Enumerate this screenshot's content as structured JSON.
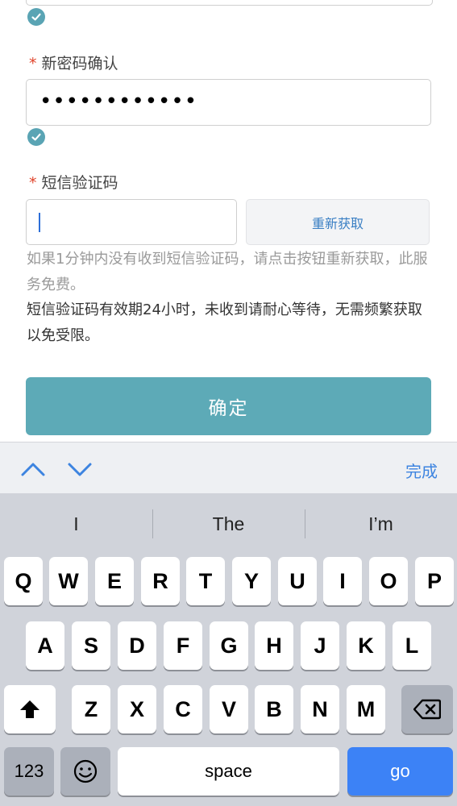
{
  "form": {
    "check_top": "check",
    "new_pwd_confirm_label": "新密码确认",
    "new_pwd_confirm_value": "••••••••••••",
    "sms_label": "短信验证码",
    "sms_input_value": "",
    "resend_label": "重新获取",
    "hint1": "如果1分钟内没有收到短信验证码，请点击按钮重新获取，此服务免费。",
    "hint2": "短信验证码有效期24小时，未收到请耐心等待，无需频繁获取以免受限。",
    "submit_label": "确定",
    "required_mark": "*"
  },
  "accessory": {
    "done_label": "完成"
  },
  "keyboard": {
    "suggestions": [
      "I",
      "The",
      "I’m"
    ],
    "row1": [
      "Q",
      "W",
      "E",
      "R",
      "T",
      "Y",
      "U",
      "I",
      "O",
      "P"
    ],
    "row2": [
      "A",
      "S",
      "D",
      "F",
      "G",
      "H",
      "J",
      "K",
      "L"
    ],
    "row3": [
      "Z",
      "X",
      "C",
      "V",
      "B",
      "N",
      "M"
    ],
    "numbers_label": "123",
    "space_label": "space",
    "go_label": "go"
  },
  "colors": {
    "accent": "#5aa4b4",
    "button": "#5daab7",
    "link": "#3a7fc4",
    "required": "#e0442b",
    "go_key": "#3c82f6"
  }
}
